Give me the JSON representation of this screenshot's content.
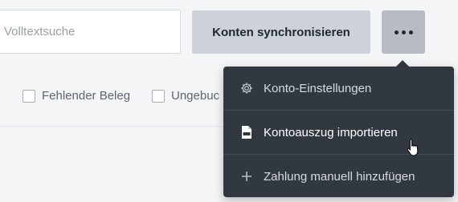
{
  "search": {
    "placeholder": "Volltextsuche"
  },
  "toolbar": {
    "sync_label": "Konten synchronisieren",
    "more_icon": "more-horizontal-icon"
  },
  "filters": [
    {
      "label": "Fehlender Beleg",
      "checked": false
    },
    {
      "label": "Ungebuc",
      "checked": false
    }
  ],
  "menu": {
    "items": [
      {
        "label": "Konto-Einstellungen",
        "icon": "gear-icon"
      },
      {
        "label": "Kontoauszug importieren",
        "icon": "csv-file-icon"
      },
      {
        "label": "Zahlung manuell hinzufügen",
        "icon": "plus-icon"
      }
    ]
  },
  "colors": {
    "menu_bg": "#323840",
    "page_bg": "#f4f5f7",
    "button_bg": "#cdd2da"
  }
}
